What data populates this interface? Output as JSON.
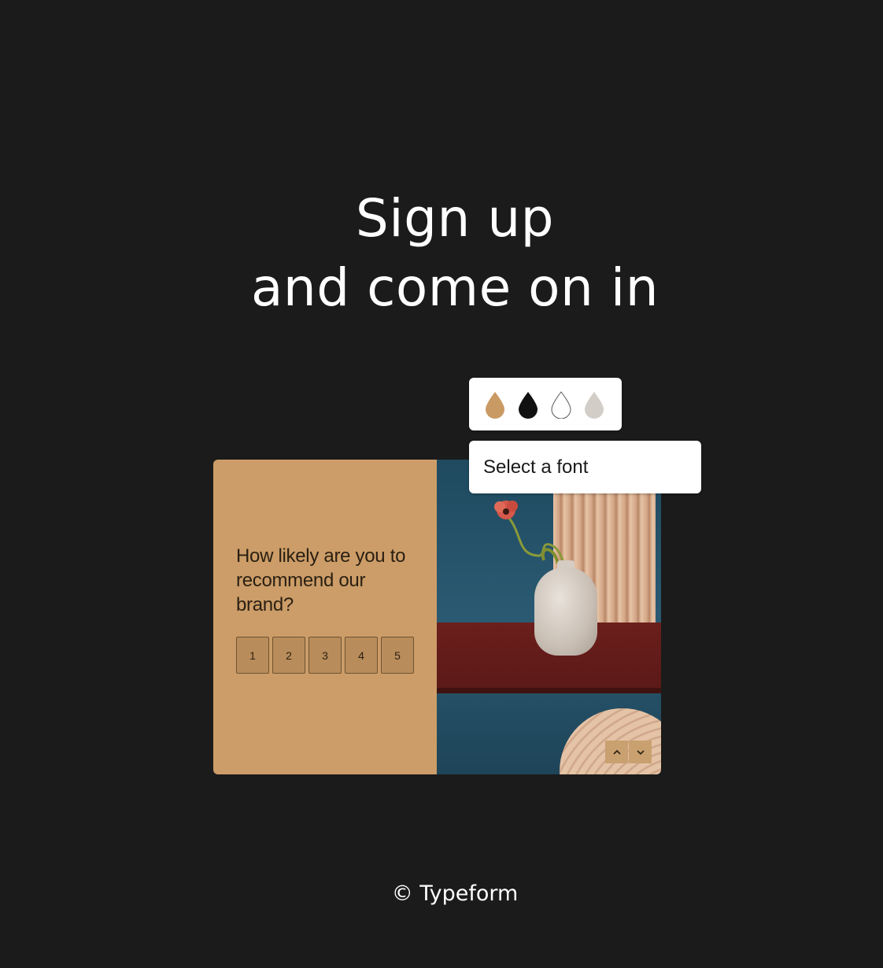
{
  "headline": {
    "line1": "Sign up",
    "line2": "and come on in"
  },
  "theme_picker": {
    "swatches": [
      {
        "name": "tan",
        "color": "#c99a63"
      },
      {
        "name": "black",
        "color": "#111111"
      },
      {
        "name": "white",
        "color": "#ffffff"
      },
      {
        "name": "light-gray",
        "color": "#d3cdc8"
      }
    ]
  },
  "font_selector": {
    "label": "Select a font"
  },
  "form_preview": {
    "question": "How likely are you to recommend our brand?",
    "scale": [
      "1",
      "2",
      "3",
      "4",
      "5"
    ],
    "accent_color": "#cc9d68"
  },
  "footer": {
    "copyright": "© Typeform"
  }
}
